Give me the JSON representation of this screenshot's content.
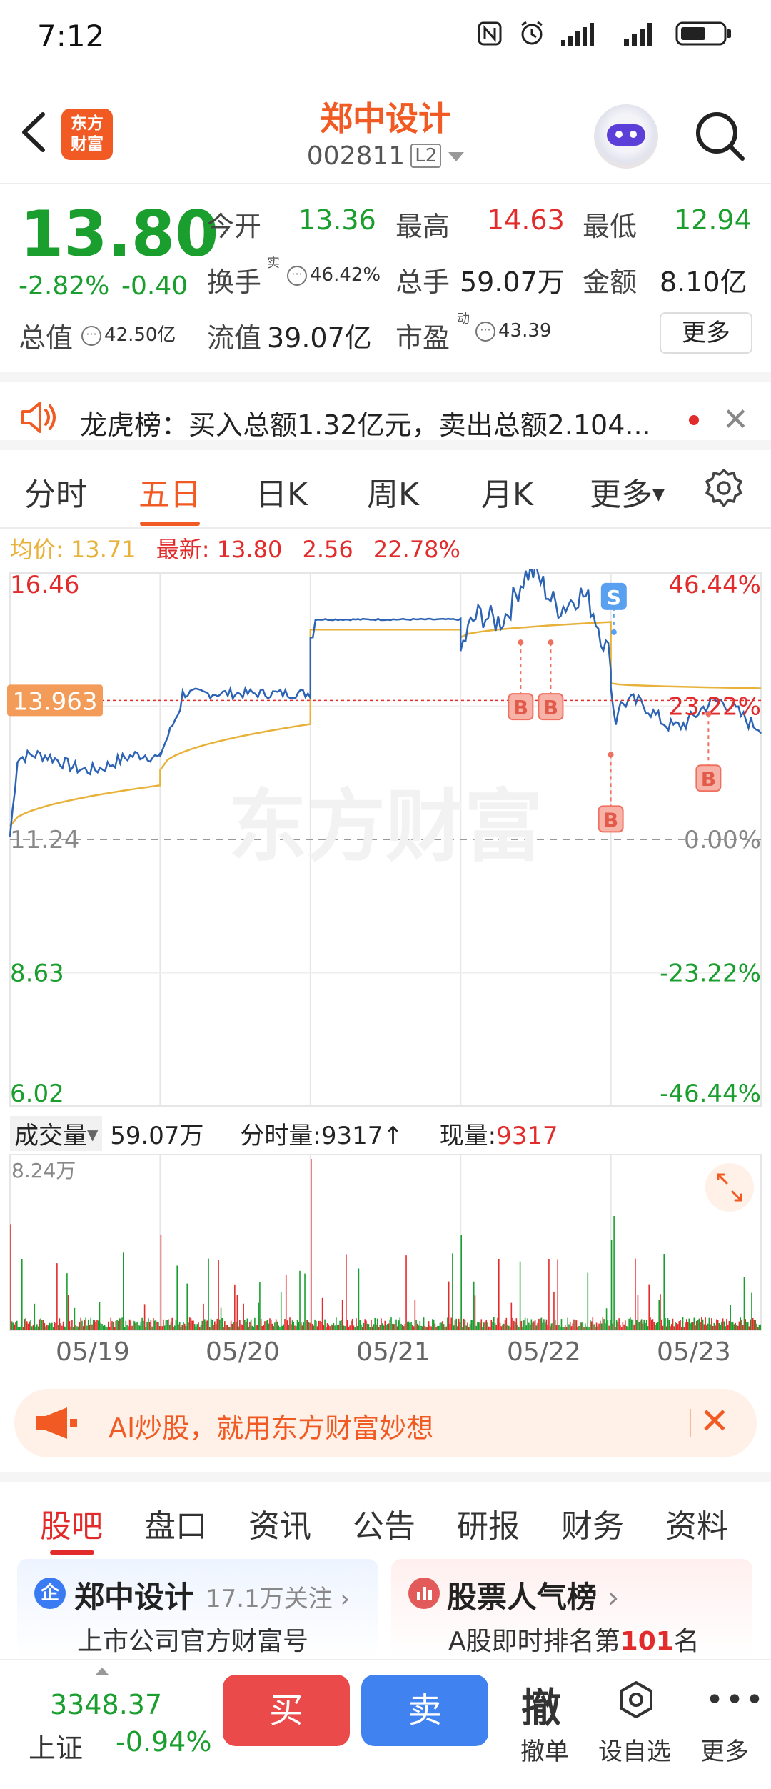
{
  "status_bar": {
    "time": "7:12"
  },
  "header": {
    "logo_line1": "东方",
    "logo_line2": "财富",
    "title": "郑中设计",
    "code": "002811",
    "level_badge": "L2"
  },
  "quote": {
    "price": "13.80",
    "change_pct": "-2.82%",
    "change_amt": "-0.40",
    "open_label": "今开",
    "open": "13.36",
    "high_label": "最高",
    "high": "14.63",
    "low_label": "最低",
    "low": "12.94",
    "turnover_label": "换手",
    "turnover_sup": "实",
    "turnover": "46.42%",
    "volume_label": "总手",
    "volume": "59.07万",
    "amount_label": "金额",
    "amount": "8.10亿",
    "mktcap_label": "总值",
    "mktcap": "42.50亿",
    "float_label": "流值",
    "float": "39.07亿",
    "pe_label": "市盈",
    "pe_sup": "动",
    "pe": "43.39",
    "more_label": "更多"
  },
  "notice": {
    "text": "龙虎榜：买入总额1.32亿元，卖出总额2.104..."
  },
  "chart_tabs": {
    "items": [
      "分时",
      "五日",
      "日K",
      "周K",
      "月K",
      "更多"
    ],
    "active_index": 1
  },
  "info_row": {
    "avg_label": "均价:",
    "avg": "13.71",
    "latest_label": "最新:",
    "latest": "13.80",
    "chg": "2.56",
    "pct": "22.78%"
  },
  "chart_data": {
    "type": "line",
    "title": "",
    "price_ticks": [
      "16.46",
      "13.85",
      "11.24",
      "8.63",
      "6.02"
    ],
    "pct_ticks": [
      "46.44%",
      "23.22%",
      "0.00%",
      "-23.22%",
      "-46.44%"
    ],
    "ylim": [
      6.02,
      16.46
    ],
    "base_price": 11.24,
    "crosshair_price": "13.963",
    "watermark": "东方财富",
    "x_labels": [
      "05/19",
      "05/20",
      "05/21",
      "05/22",
      "05/23"
    ],
    "series": [
      {
        "name": "price",
        "color": "#2d63b4"
      },
      {
        "name": "average",
        "color": "#e8b23a"
      }
    ],
    "markers": [
      {
        "label": "B",
        "day": 3,
        "frac": 0.4
      },
      {
        "label": "B",
        "day": 3,
        "frac": 0.6
      },
      {
        "label": "S",
        "day": 4,
        "frac": 0.02
      },
      {
        "label": "B",
        "day": 4,
        "frac": 0.0
      },
      {
        "label": "B",
        "day": 4,
        "frac": 0.65
      }
    ],
    "volume_max_label": "8.24万"
  },
  "volume_header": {
    "label": "成交量",
    "total": "59.07万",
    "tick_label": "分时量:",
    "tick_value": "9317↑",
    "now_label": "现量:",
    "now_value": "9317"
  },
  "ad": {
    "text": "AI炒股，就用东方财富妙想"
  },
  "bottom_tabs": {
    "items": [
      "股吧",
      "盘口",
      "资讯",
      "公告",
      "研报",
      "财务",
      "资料"
    ],
    "active_index": 0
  },
  "cards": {
    "left_title": "郑中设计",
    "left_follow": "17.1万关注",
    "left_sub": "上市公司官方财富号",
    "right_title": "股票人气榜",
    "right_sub_prefix": "A股即时排名第",
    "right_rank": "101",
    "right_sub_suffix": "名"
  },
  "bottom_bar": {
    "index_value": "3348.37",
    "index_name": "上证",
    "index_pct": "-0.94%",
    "buy": "买",
    "sell": "卖",
    "cancel_big": "撤",
    "cancel": "撤单",
    "watchlist": "设自选",
    "more": "更多"
  }
}
